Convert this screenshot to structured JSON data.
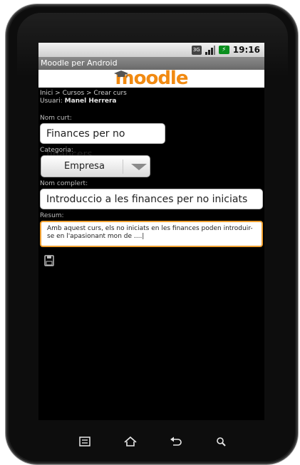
{
  "status_bar": {
    "network": "3G",
    "time": "19:16"
  },
  "app": {
    "title": "Moodle per Android",
    "logo_text": "moodle"
  },
  "page": {
    "breadcrumb": "Inici > Cursos > Crear curs",
    "user_label": "Usuari:",
    "user_name": "Manel Herrera"
  },
  "form": {
    "short_name_label": "Nom curt:",
    "short_name_value": "Finances per no financers",
    "category_label": "Categoria:",
    "category_value": "Empresa",
    "full_name_label": "Nom complert:",
    "full_name_value": "Introduccio a les finances per no iniciats",
    "summary_label": "Resum:",
    "summary_value": "Amb aquest curs, els no iniciats en les finances poden introduir-se en l'apasionant mon de ....|"
  },
  "colors": {
    "accent": "#f18a12",
    "focus_border": "#f0a030",
    "battery": "#0a8f1e"
  },
  "icons": [
    "menu-icon",
    "home-icon",
    "back-icon",
    "search-icon",
    "save-icon",
    "signal-icon",
    "battery-icon"
  ]
}
